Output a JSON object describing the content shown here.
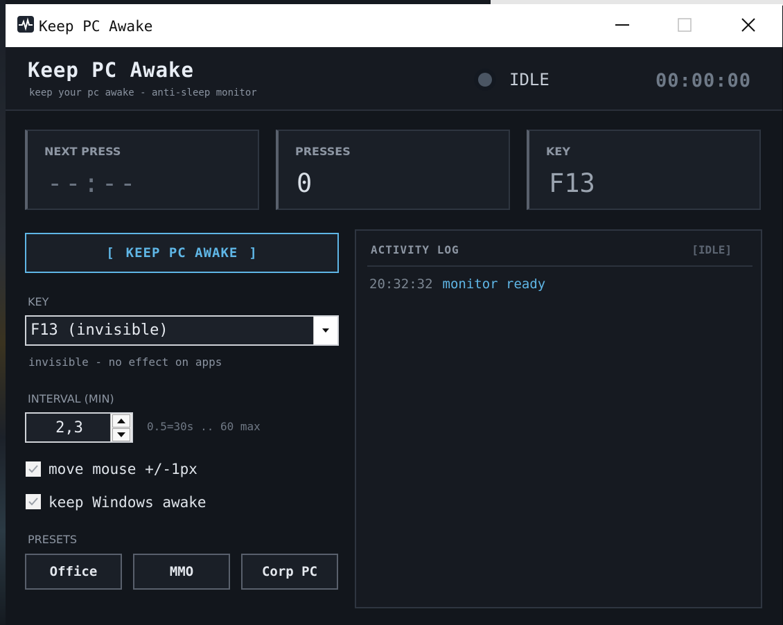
{
  "window": {
    "title": "Keep PC Awake"
  },
  "header": {
    "title": "Keep PC Awake",
    "subtitle": "keep your pc awake - anti-sleep monitor",
    "status": "IDLE",
    "timer": "00:00:00"
  },
  "stats": {
    "next_press": {
      "label": "NEXT PRESS",
      "value": "--:--"
    },
    "presses": {
      "label": "PRESSES",
      "value": "0"
    },
    "key": {
      "label": "KEY",
      "value": "F13"
    }
  },
  "controls": {
    "keep_awake_button": {
      "open": "[",
      "label": "KEEP PC AWAKE",
      "close": "]"
    },
    "key_label": "KEY",
    "key_selected": "F13 (invisible)",
    "key_hint": "invisible - no effect on apps",
    "interval_label": "INTERVAL (MIN)",
    "interval_value": "2,3",
    "interval_hint": "0.5=30s .. 60 max",
    "move_mouse": {
      "label": "move mouse +/-1px",
      "checked": true
    },
    "keep_windows_awake": {
      "label": "keep Windows awake",
      "checked": true
    },
    "presets_label": "PRESETS",
    "presets": [
      "Office",
      "MMO",
      "Corp PC"
    ]
  },
  "log": {
    "title": "ACTIVITY LOG",
    "state": "[IDLE]",
    "entries": [
      {
        "time": "20:32:32",
        "message": "monitor ready"
      }
    ]
  },
  "colors": {
    "accent": "#5fb6e6",
    "background": "#12161c",
    "panel": "#1a1f27",
    "idle_dot": "#4a5563"
  }
}
